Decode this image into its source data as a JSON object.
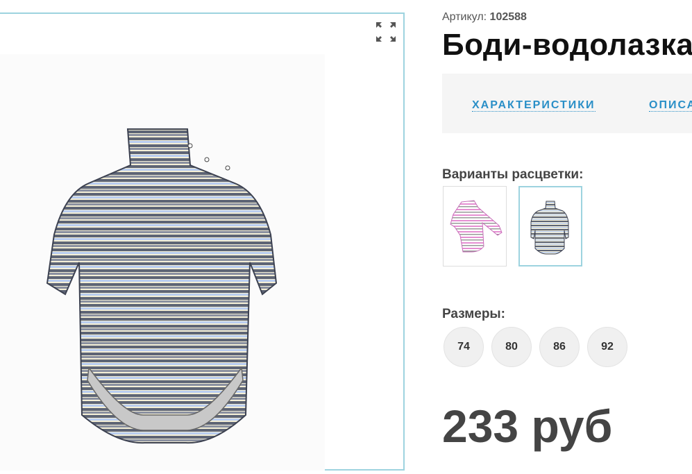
{
  "product": {
    "sku_label": "Артикул:",
    "sku_value": "102588",
    "title": "Боди-водолазка"
  },
  "gallery": {
    "expand_icon": "expand-arrows-icon",
    "border_color": "#9dd3df"
  },
  "tabs": [
    {
      "label": "ХАРАКТЕРИСТИКИ"
    },
    {
      "label": "ОПИСАНИЕ"
    }
  ],
  "colors": {
    "label": "Варианты расцветки:",
    "options": [
      {
        "name": "pink-stripes",
        "selected": false
      },
      {
        "name": "grey-blue-stripes",
        "selected": true
      }
    ]
  },
  "sizes": {
    "label": "Размеры:",
    "options": [
      "74",
      "80",
      "86",
      "92"
    ]
  },
  "price": {
    "text": "233 руб"
  },
  "theme": {
    "accent": "#2a8fc7",
    "stripe_dark": "#5d6475",
    "stripe_blue": "#b9cdf0",
    "stripe_cream": "#f4efd6"
  }
}
